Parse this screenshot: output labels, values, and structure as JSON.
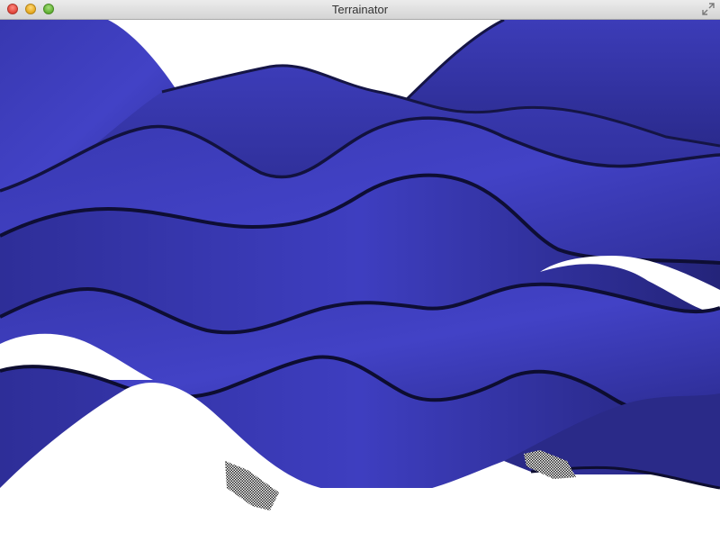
{
  "window": {
    "title": "Terrainator"
  },
  "icons": {
    "close": "close-icon",
    "minimize": "minimize-icon",
    "zoom": "zoom-icon",
    "fullscreen": "fullscreen-icon"
  },
  "colors": {
    "terrain_light": "#4040c4",
    "terrain_mid": "#3434a4",
    "terrain_dark": "#26267a",
    "terrain_shadow": "#10103a",
    "background": "#ffffff"
  }
}
